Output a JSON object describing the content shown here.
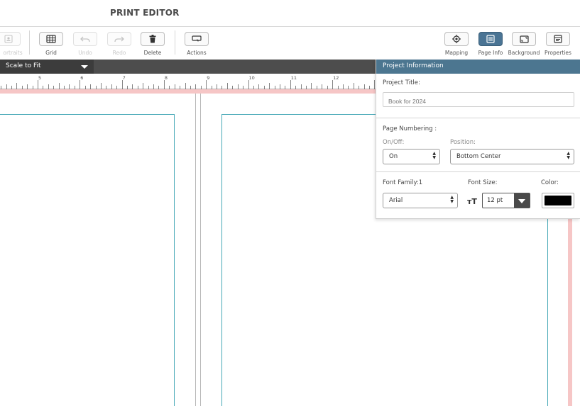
{
  "header": {
    "title": "PRINT EDITOR"
  },
  "toolbar": {
    "portraits_label": "ortraits",
    "grid_label": "Grid",
    "undo_label": "Undo",
    "redo_label": "Redo",
    "delete_label": "Delete",
    "actions_label": "Actions",
    "mapping_label": "Mapping",
    "page_info_label": "Page Info",
    "background_label": "Background",
    "properties_label": "Properties"
  },
  "scale": {
    "selected": "Scale to Fit"
  },
  "ruler": {
    "ticks": [
      "5",
      "6",
      "7",
      "8",
      "9",
      "10",
      "11",
      "12"
    ]
  },
  "panel": {
    "title": "Project Information",
    "project_title_label": "Project Title:",
    "project_title_placeholder": "Book for 2024",
    "page_numbering_label": "Page Numbering :",
    "onoff_label": "On/Off:",
    "onoff_value": "On",
    "position_label": "Position:",
    "position_value": "Bottom Center",
    "font_family_label": "Font Family:1",
    "font_family_value": "Arial",
    "font_size_label": "Font Size:",
    "font_size_value": "12 pt",
    "color_label": "Color:",
    "color_value": "#000000"
  },
  "colors": {
    "accent": "#4c7690",
    "page_border": "#47a9b7",
    "bleed": "#f6c6c6"
  }
}
